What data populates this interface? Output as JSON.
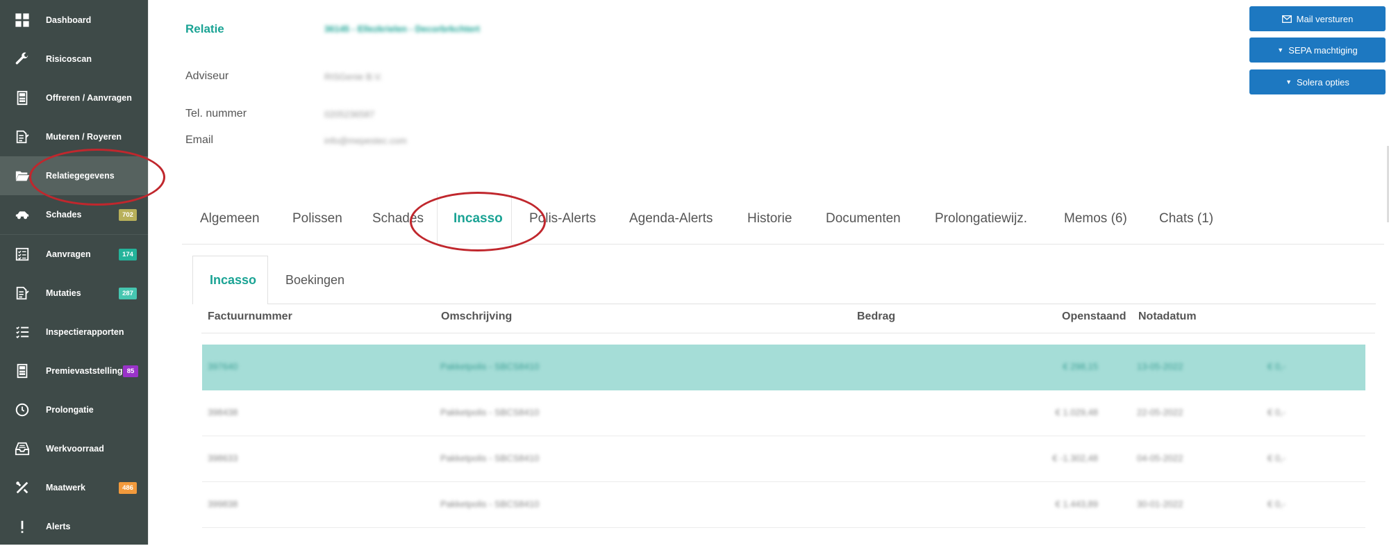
{
  "sidebar": {
    "items": [
      {
        "label": "Dashboard",
        "icon": "grid-icon"
      },
      {
        "label": "Risicoscan",
        "icon": "wrench-icon"
      },
      {
        "label": "Offreren / Aanvragen",
        "icon": "calculator-icon"
      },
      {
        "label": "Muteren / Royeren",
        "icon": "document-edit-icon"
      },
      {
        "label": "Relatiegegevens",
        "icon": "folder-open-icon"
      },
      {
        "label": "Schades",
        "icon": "car-icon",
        "badge": "702",
        "badge_color": "#b8b05a"
      },
      {
        "label": "Aanvragen",
        "icon": "checklist-icon",
        "badge": "174",
        "badge_color": "#24b39a"
      },
      {
        "label": "Mutaties",
        "icon": "document-edit-icon",
        "badge": "287",
        "badge_color": "#46c6b0"
      },
      {
        "label": "Inspectierapporten",
        "icon": "list-check-icon"
      },
      {
        "label": "Premievaststelling",
        "icon": "calculator-icon",
        "badge": "85",
        "badge_color": "#9a33c9"
      },
      {
        "label": "Prolongatie",
        "icon": "clock-icon"
      },
      {
        "label": "Werkvoorraad",
        "icon": "inbox-icon"
      },
      {
        "label": "Maatwerk",
        "icon": "tools-icon",
        "badge": "486",
        "badge_color": "#f29a3c"
      },
      {
        "label": "Alerts",
        "icon": "exclamation-icon"
      }
    ]
  },
  "relation": {
    "relatie_label": "Relatie",
    "relatie_value": "36145 - Ellezkrielen - Decorbrkchtert",
    "adviseur_label": "Adviseur",
    "adviseur_value": "RISGenie B.V.",
    "tel_label": "Tel. nummer",
    "tel_value": "0205236587",
    "email_label": "Email",
    "email_value": "info@mepestec.com"
  },
  "actions": {
    "mail": "Mail versturen",
    "sepa": "SEPA machtiging",
    "solera": "Solera opties"
  },
  "tabs": [
    "Algemeen",
    "Polissen",
    "Schades",
    "Incasso",
    "Polis-Alerts",
    "Agenda-Alerts",
    "Historie",
    "Documenten",
    "Prolongatiewijz.",
    "Memos (6)",
    "Chats (1)"
  ],
  "subtabs": [
    "Incasso",
    "Boekingen"
  ],
  "table": {
    "headers": {
      "factuur": "Factuurnummer",
      "omschrijving": "Omschrijving",
      "bedrag": "Bedrag",
      "openstaand": "Openstaand",
      "notadatum": "Notadatum"
    },
    "rows": [
      {
        "factuur": "397640",
        "omschrijving": "Pakketpolis - SBCS8410",
        "bedrag": "€ 298,15",
        "openstaand": "€ 0,-",
        "notadatum": "13-05-2022"
      },
      {
        "factuur": "398438",
        "omschrijving": "Pakketpolis - SBCS8410",
        "bedrag": "€ 1.029,48",
        "openstaand": "€ 0,-",
        "notadatum": "22-05-2022"
      },
      {
        "factuur": "398633",
        "omschrijving": "Pakketpolis - SBCS8410",
        "bedrag": "€ -1.302,48",
        "openstaand": "€ 0,-",
        "notadatum": "04-05-2022"
      },
      {
        "factuur": "399838",
        "omschrijving": "Pakketpolis - SBCS8410",
        "bedrag": "€ 1.443,89",
        "openstaand": "€ 0,-",
        "notadatum": "30-01-2022"
      }
    ]
  }
}
